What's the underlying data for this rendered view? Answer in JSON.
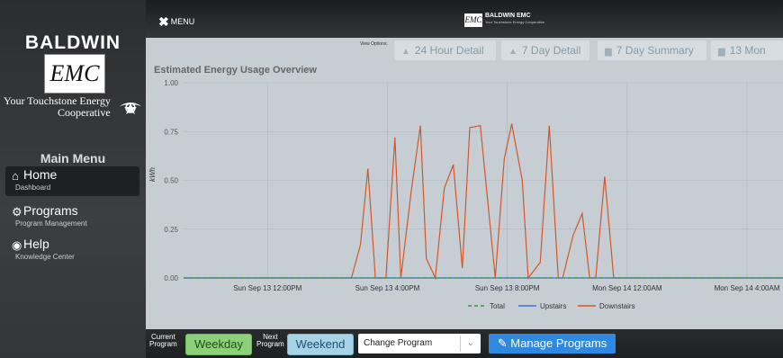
{
  "sidebar": {
    "brand": "BALDWIN",
    "logo": "EMC",
    "tagline_line1": "Your Touchstone Energy",
    "tagline_line2": "Cooperative",
    "menu_title": "Main Menu",
    "items": [
      {
        "label": "Home",
        "sub": "Dashboard",
        "icon": "home-icon"
      },
      {
        "label": "Programs",
        "sub": "Program Management",
        "icon": "gears-icon"
      },
      {
        "label": "Help",
        "sub": "Knowledge Center",
        "icon": "lifebuoy-icon"
      }
    ]
  },
  "topbar": {
    "menu_label": "MENU",
    "logo_box": "EMC",
    "logo_name": "BALDWIN EMC",
    "logo_tagline": "Your Touchstone Energy Cooperative"
  },
  "view_options": {
    "label": "View Options:",
    "buttons": [
      "24 Hour Detail",
      "7 Day Detail",
      "7 Day Summary",
      "13 Mon"
    ]
  },
  "chart_data": {
    "type": "line",
    "title": "Estimated Energy Usage Overview",
    "ylabel": "kWh",
    "ylim": [
      0,
      1.0
    ],
    "yticks": [
      "1.00",
      "0.75",
      "0.50",
      "0.25",
      "0.00"
    ],
    "xticks": [
      "Sun Sep 13 12:00PM",
      "Sun Sep 13 4:00PM",
      "Sun Sep 13 8:00PM",
      "Mon Sep 14 12:00AM",
      "Mon Sep 14 4:00AM"
    ],
    "grid": true,
    "legend_position": "bottom-center",
    "series": [
      {
        "name": "Total",
        "color": "#2e9e3e",
        "dash": true,
        "x": [
          0,
          27.6
        ],
        "y": [
          0,
          0
        ]
      },
      {
        "name": "Upstairs",
        "color": "#3f6fd6",
        "x": [
          0,
          27.6
        ],
        "y": [
          0,
          0
        ]
      },
      {
        "name": "Downstairs",
        "color": "#d4572a",
        "x": [
          0,
          5.6,
          5.9,
          6.15,
          6.4,
          6.75,
          7.05,
          7.25,
          7.6,
          7.9,
          8.1,
          8.4,
          8.7,
          9.0,
          9.3,
          9.55,
          9.9,
          10.4,
          10.7,
          10.95,
          11.3,
          11.5,
          11.9,
          12.2,
          12.5,
          12.65,
          13.0,
          13.3,
          13.55,
          13.75,
          14.05,
          14.35,
          14.6,
          27.6
        ],
        "y": [
          0,
          0,
          0.17,
          0.56,
          0,
          0,
          0.72,
          0,
          0.45,
          0.78,
          0.1,
          0,
          0.46,
          0.58,
          0.05,
          0.77,
          0.78,
          0,
          0.61,
          0.79,
          0.5,
          0,
          0.08,
          0.78,
          0,
          0,
          0.22,
          0.33,
          0,
          0,
          0.52,
          0,
          0,
          0
        ]
      }
    ]
  },
  "bottombar": {
    "current_label_1": "Current",
    "current_label_2": "Program",
    "current_value": "Weekday",
    "next_label_1": "Next",
    "next_label_2": "Program",
    "next_value": "Weekend",
    "change_program": "Change Program",
    "manage_label": "Manage Programs"
  }
}
